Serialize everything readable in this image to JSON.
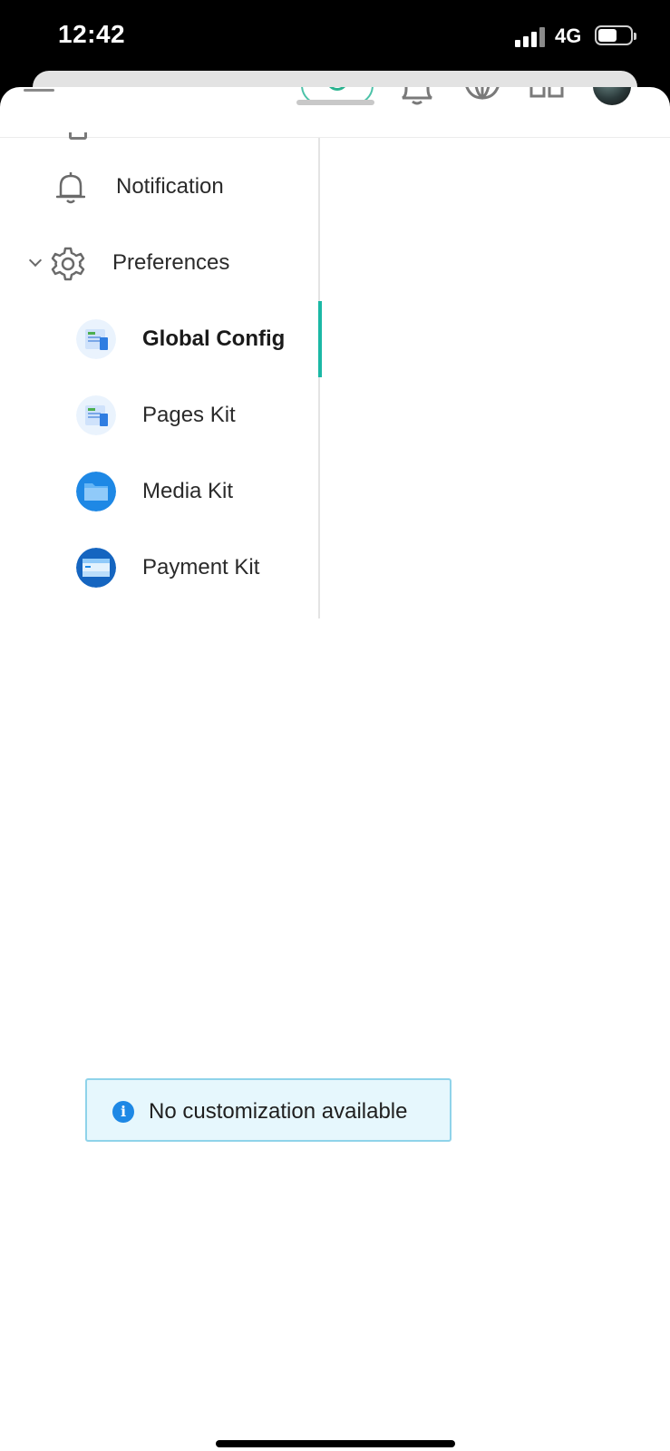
{
  "status_bar": {
    "time": "12:42",
    "network": "4G",
    "signal_bars": 4,
    "signal_strength": 3,
    "battery_level": 0.55
  },
  "header": {
    "icons": [
      "menu-icon",
      "support-icon",
      "bell-icon",
      "globe-icon",
      "apps-icon",
      "avatar"
    ]
  },
  "sidebar": {
    "items": [
      {
        "label": "Notification",
        "icon": "bell-icon"
      },
      {
        "label": "Preferences",
        "icon": "gear-icon",
        "expanded": true
      },
      {
        "label": "Global Config",
        "icon": "config-app-icon",
        "active": true
      },
      {
        "label": "Pages Kit",
        "icon": "pages-kit-icon"
      },
      {
        "label": "Media Kit",
        "icon": "media-kit-icon"
      },
      {
        "label": "Payment Kit",
        "icon": "payment-kit-icon"
      }
    ]
  },
  "toast": {
    "icon": "info-icon",
    "message": "No customization available"
  },
  "colors": {
    "accent": "#1bb8a5",
    "info": "#1e88e5",
    "toast_bg": "#e6f7fd",
    "toast_border": "#8fd3ea"
  }
}
